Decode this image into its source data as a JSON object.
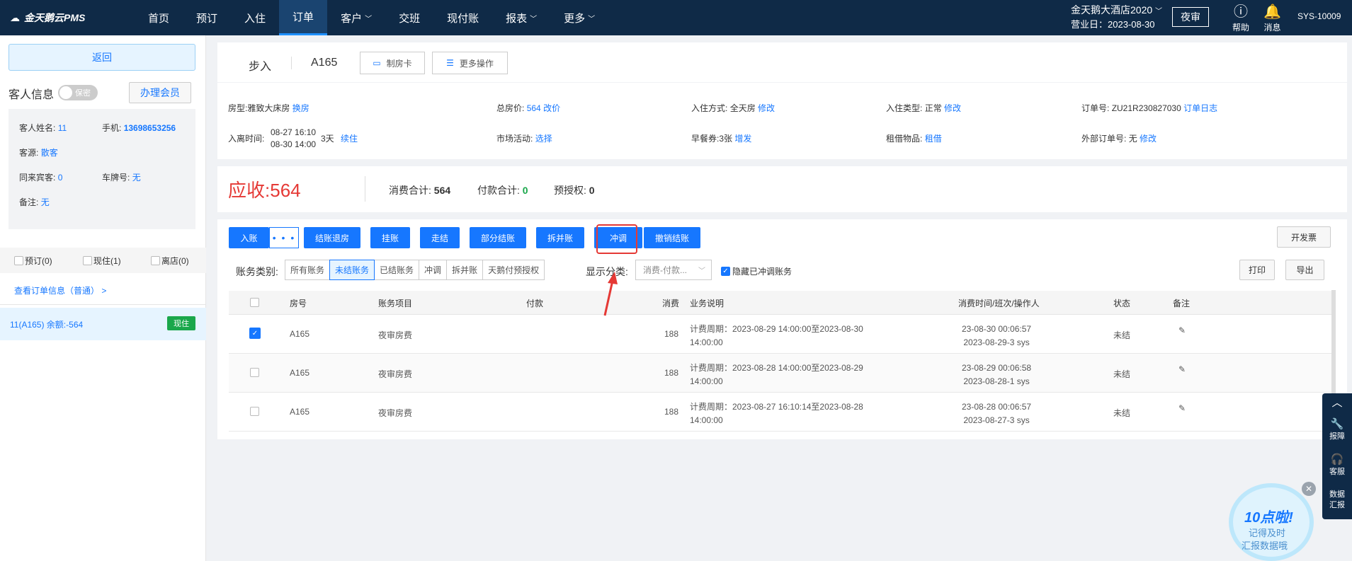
{
  "app": {
    "logo_text": "金天鹅云PMS"
  },
  "nav": {
    "items": [
      {
        "label": "首页",
        "active": false,
        "dropdown": false
      },
      {
        "label": "预订",
        "active": false,
        "dropdown": false
      },
      {
        "label": "入住",
        "active": false,
        "dropdown": false
      },
      {
        "label": "订单",
        "active": true,
        "dropdown": false
      },
      {
        "label": "客户",
        "active": false,
        "dropdown": true
      },
      {
        "label": "交班",
        "active": false,
        "dropdown": false
      },
      {
        "label": "现付账",
        "active": false,
        "dropdown": false
      },
      {
        "label": "报表",
        "active": false,
        "dropdown": true
      },
      {
        "label": "更多",
        "active": false,
        "dropdown": true
      }
    ],
    "hotel_name": "金天鹅大酒店2020",
    "business_date": "营业日：2023-08-30",
    "night_audit": "夜审",
    "help": "帮助",
    "messages": "消息",
    "user": "SYS-10009"
  },
  "sidebar": {
    "back": "返回",
    "guest_info_title": "客人信息",
    "privacy_toggle": "保密",
    "member_button": "办理会员",
    "guest": {
      "name_label": "客人姓名:",
      "name_value": "11",
      "phone_label": "手机:",
      "phone_value": "13698653256",
      "source_label": "客源:",
      "source_value": "散客",
      "companions_label": "同来宾客:",
      "companions_value": "0",
      "plate_label": "车牌号:",
      "plate_value": "无",
      "remark_label": "备注:",
      "remark_value": "无"
    },
    "tabs": [
      "预订(0)",
      "现住(1)",
      "离店(0)"
    ],
    "view_order": "查看订单信息（普通）  >",
    "room_entry": "11(A165)   余额:-564",
    "room_status": "现住"
  },
  "order_header": {
    "type": "步入",
    "room": "A165",
    "make_card": "制房卡",
    "more_ops": "更多操作"
  },
  "order_info": {
    "room_type_label": "房型:",
    "room_type_value": "雅致大床房",
    "room_type_action": "换房",
    "total_label": "总房价:",
    "total_value": "564",
    "total_action": "改价",
    "checkin_mode_label": "入住方式:",
    "checkin_mode_value": "全天房",
    "checkin_mode_action": "修改",
    "checkin_type_label": "入住类型:",
    "checkin_type_value": "正常",
    "checkin_type_action": "修改",
    "order_no_label": "订单号:",
    "order_no_value": "ZU21R230827030",
    "order_log": "订单日志",
    "time_label": "入离时间:",
    "time_in": "08-27 16:10",
    "time_out": "08-30 14:00",
    "nights": "3天",
    "extend": "续住",
    "market_label": "市场活动:",
    "market_action": "选择",
    "breakfast_label": "早餐券:",
    "breakfast_value": "3张",
    "breakfast_action": "增发",
    "rental_label": "租借物品:",
    "rental_action": "租借",
    "ext_order_label": "外部订单号:",
    "ext_order_value": "无",
    "ext_order_action": "修改"
  },
  "summary": {
    "due_label": "应收:",
    "due_value": "564",
    "consume_label": "消费合计:",
    "consume_value": "564",
    "pay_label": "付款合计:",
    "pay_value": "0",
    "preauth_label": "预授权:",
    "preauth_value": "0"
  },
  "actions": {
    "post": "入账",
    "more": "• • •",
    "settle_checkout": "结账退房",
    "hang": "挂账",
    "walk": "走结",
    "partial": "部分结账",
    "split_merge": "拆并账",
    "reverse": "冲调",
    "cancel_settle": "撤销结账",
    "invoice": "开发票",
    "print": "打印",
    "export": "导出"
  },
  "filters": {
    "label": "账务类别:",
    "segments": [
      "所有账务",
      "未结账务",
      "已结账务",
      "冲调",
      "拆并账",
      "天鹅付预授权"
    ],
    "active_index": 1,
    "display_label": "显示分类:",
    "display_value": "消费-付款...",
    "hide_reversed": "隐藏已冲调账务"
  },
  "table": {
    "headers": [
      "房号",
      "账务项目",
      "付款",
      "消费",
      "业务说明",
      "消费时间/班次/操作人",
      "状态",
      "备注"
    ],
    "rows": [
      {
        "checked": true,
        "room": "A165",
        "item": "夜审房费",
        "payment": "",
        "amount": "188",
        "desc1": "计费周期：2023-08-29 14:00:00至2023-08-30",
        "desc2": "14:00:00",
        "time1": "23-08-30 00:06:57",
        "time2": "2023-08-29-3 sys",
        "status": "未结"
      },
      {
        "checked": false,
        "room": "A165",
        "item": "夜审房费",
        "payment": "",
        "amount": "188",
        "desc1": "计费周期：2023-08-28 14:00:00至2023-08-29",
        "desc2": "14:00:00",
        "time1": "23-08-29 00:06:58",
        "time2": "2023-08-28-1 sys",
        "status": "未结"
      },
      {
        "checked": false,
        "room": "A165",
        "item": "夜审房费",
        "payment": "",
        "amount": "188",
        "desc1": "计费周期：2023-08-27 16:10:14至2023-08-28",
        "desc2": "14:00:00",
        "time1": "23-08-28 00:06:57",
        "time2": "2023-08-27-3 sys",
        "status": "未结"
      }
    ]
  },
  "float_panel": {
    "report": "报障",
    "service": "客服",
    "data": "数据",
    "data2": "汇报"
  },
  "promo": {
    "title": "10点啦!",
    "line1": "记得及时",
    "line2": "汇报数据哦"
  },
  "colors": {
    "nav_bg": "#0f2a47",
    "primary": "#1677ff",
    "danger": "#e53935",
    "success": "#1aa74b"
  }
}
